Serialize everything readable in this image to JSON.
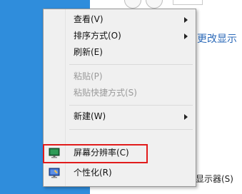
{
  "window": {
    "link_text": "更改显示",
    "display_label": "显示器(S)"
  },
  "context_menu": {
    "items": [
      {
        "label": "查看(V)",
        "has_submenu": true,
        "enabled": true
      },
      {
        "label": "排序方式(O)",
        "has_submenu": true,
        "enabled": true
      },
      {
        "label": "刷新(E)",
        "has_submenu": false,
        "enabled": true
      },
      {
        "label": "粘贴(P)",
        "has_submenu": false,
        "enabled": false
      },
      {
        "label": "粘贴快捷方式(S)",
        "has_submenu": false,
        "enabled": false
      },
      {
        "label": "新建(W)",
        "has_submenu": true,
        "enabled": true
      },
      {
        "label": "屏幕分辨率(C)",
        "has_submenu": false,
        "enabled": true,
        "icon": "display-icon",
        "highlighted": true
      },
      {
        "label": "个性化(R)",
        "has_submenu": false,
        "enabled": true,
        "icon": "personalize-icon"
      }
    ]
  },
  "colors": {
    "desktop": "#2f8ddc",
    "menu_background": "#f0f0f0",
    "highlight_border": "#e11b1b",
    "link": "#2b69b8"
  }
}
